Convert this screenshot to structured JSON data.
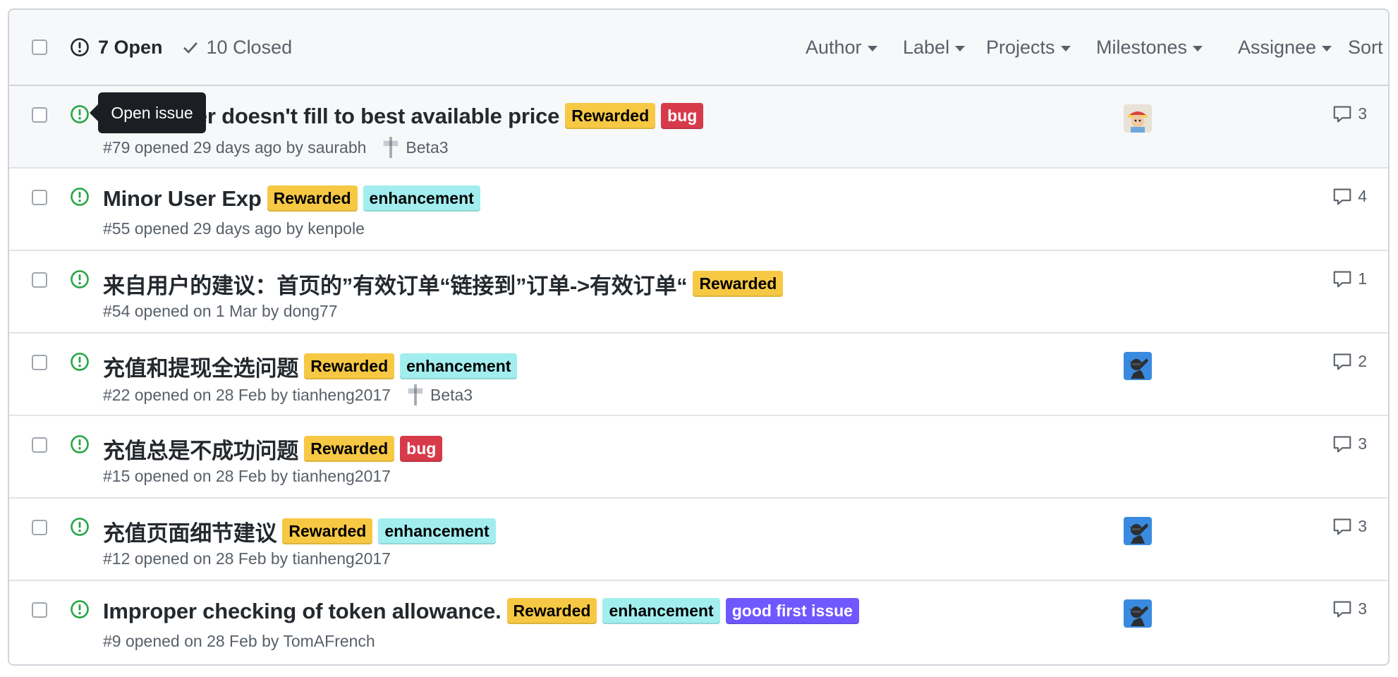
{
  "header": {
    "open_label": "7 Open",
    "closed_label": "10 Closed",
    "filters": [
      "Author",
      "Label",
      "Projects",
      "Milestones",
      "Assignee",
      "Sort"
    ]
  },
  "tooltip": "Open issue",
  "colors": {
    "open_green": "#28a745",
    "rewarded": "#f7c843",
    "bug": "#d73a4a",
    "enhancement": "#a2eeef",
    "good_first_issue": "#7057ff"
  },
  "issues": [
    {
      "title": "Limit order doesn't fill to best available price",
      "labels": [
        "Rewarded",
        "bug"
      ],
      "meta": "#79 opened 29 days ago by saurabh",
      "milestone": "Beta3",
      "avatar": "avatar-pirate",
      "comments": "3"
    },
    {
      "title": "Minor User Exp",
      "labels": [
        "Rewarded",
        "enhancement"
      ],
      "meta": "#55 opened 29 days ago by kenpole",
      "milestone": "",
      "avatar": "",
      "comments": "4"
    },
    {
      "title": "来自用户的建议：首页的”有效订单“链接到”订单->有效订单“",
      "labels": [
        "Rewarded"
      ],
      "meta": "#54 opened on 1 Mar by dong77",
      "milestone": "",
      "avatar": "",
      "comments": "1"
    },
    {
      "title": "充值和提现全选问题",
      "labels": [
        "Rewarded",
        "enhancement"
      ],
      "meta": "#22 opened on 28 Feb by tianheng2017",
      "milestone": "Beta3",
      "avatar": "avatar-dab",
      "comments": "2"
    },
    {
      "title": "充值总是不成功问题",
      "labels": [
        "Rewarded",
        "bug"
      ],
      "meta": "#15 opened on 28 Feb by tianheng2017",
      "milestone": "",
      "avatar": "",
      "comments": "3"
    },
    {
      "title": "充值页面细节建议",
      "labels": [
        "Rewarded",
        "enhancement"
      ],
      "meta": "#12 opened on 28 Feb by tianheng2017",
      "milestone": "",
      "avatar": "avatar-dab",
      "comments": "3"
    },
    {
      "title": "Improper checking of token allowance.",
      "labels": [
        "Rewarded",
        "enhancement",
        "good first issue"
      ],
      "meta": "#9 opened on 28 Feb by TomAFrench",
      "milestone": "",
      "avatar": "avatar-dab",
      "comments": "3"
    }
  ]
}
